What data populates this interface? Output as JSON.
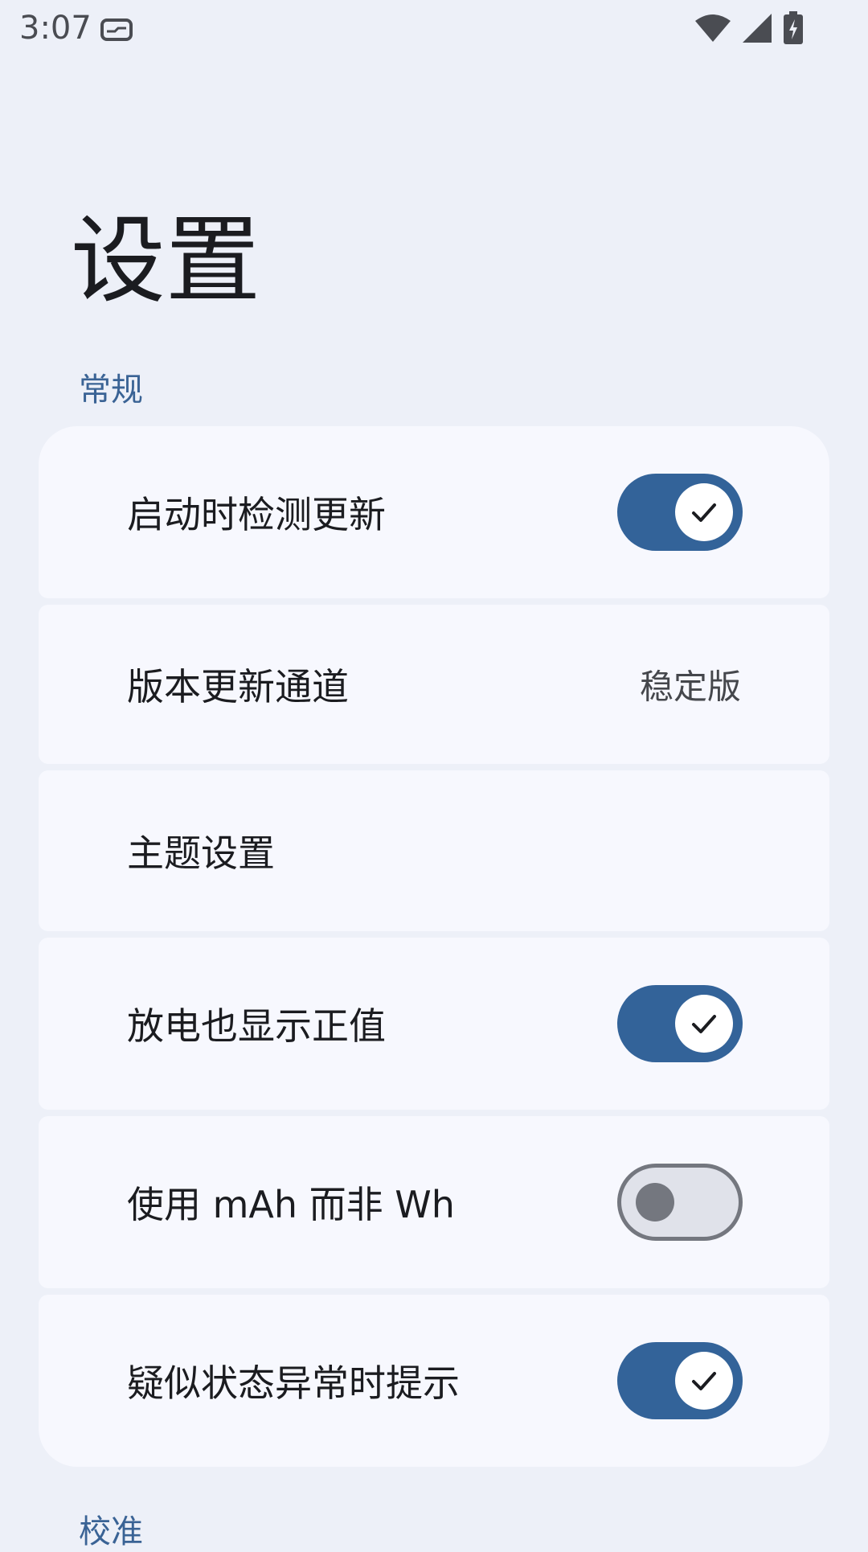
{
  "status_bar": {
    "time": "3:07",
    "icons": [
      "notification-card-icon",
      "wifi-icon",
      "cell-signal-icon",
      "battery-charging-icon"
    ]
  },
  "page": {
    "title": "设置"
  },
  "sections": [
    {
      "header": "常规",
      "items": [
        {
          "label": "启动时检测更新",
          "type": "switch",
          "checked": true
        },
        {
          "label": "版本更新通道",
          "type": "value",
          "value": "稳定版"
        },
        {
          "label": "主题设置",
          "type": "link"
        },
        {
          "label": "放电也显示正值",
          "type": "switch",
          "checked": true
        },
        {
          "label": "使用 mAh 而非 Wh",
          "type": "switch",
          "checked": false
        },
        {
          "label": "疑似状态异常时提示",
          "type": "switch",
          "checked": true
        }
      ]
    },
    {
      "header": "校准"
    }
  ],
  "colors": {
    "background": "#edf0f8",
    "card": "#f7f8fe",
    "accent": "#336399",
    "section_header": "#3a6395"
  }
}
